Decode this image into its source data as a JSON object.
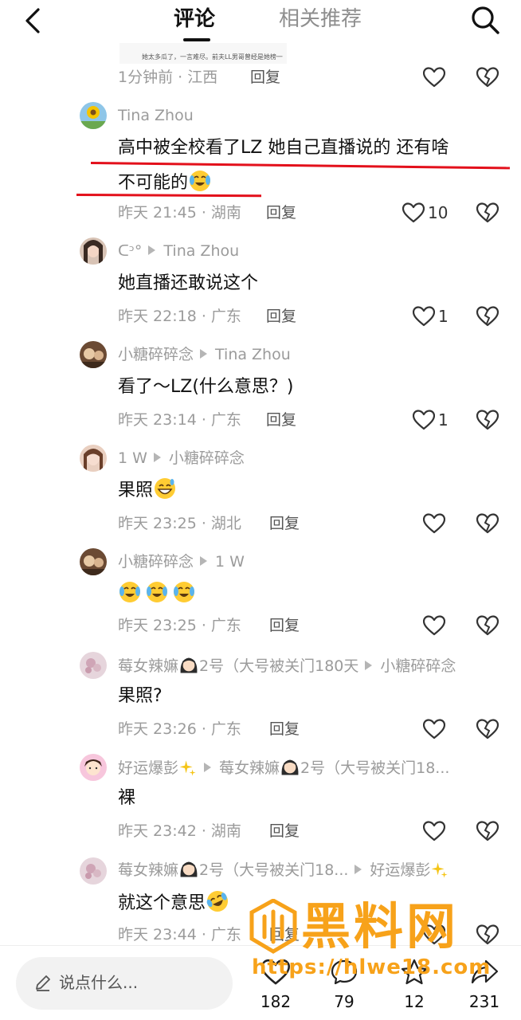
{
  "header": {
    "tab_comments": "评论",
    "tab_related": "相关推荐"
  },
  "image_sliver_text": "她太多瓜了，一言难尽。前夫LL男哥曾经是她榜一",
  "comments": [
    {
      "time": "1分钟前 · 江西",
      "reply": "回复"
    },
    {
      "user": "Tina Zhou",
      "text_line1": "高中被全校看了LZ 她自己直播说的 还有啥",
      "text_line2": "不可能的",
      "time": "昨天 21:45 · 湖南",
      "reply": "回复",
      "likes": "10"
    },
    {
      "user": "ᑕᵓ°",
      "reply_to": "Tina Zhou",
      "text": "她直播还敢说这个",
      "time": "昨天 22:18 · 广东",
      "reply": "回复",
      "likes": "1"
    },
    {
      "user": "小糖碎碎念",
      "reply_to": "Tina Zhou",
      "text": "看了～LZ(什么意思？)",
      "time": "昨天 23:14 · 广东",
      "reply": "回复",
      "likes": "1"
    },
    {
      "user": "1 W",
      "reply_to": "小糖碎碎念",
      "text": "果照",
      "time": "昨天 23:25 · 湖北",
      "reply": "回复"
    },
    {
      "user": "小糖碎碎念",
      "reply_to": "1 W",
      "text": "",
      "time": "昨天 23:25 · 广东",
      "reply": "回复"
    },
    {
      "user_a": "莓女辣嫲",
      "user_b": "2号（大号被关门180天",
      "reply_to": "小糖碎碎念",
      "text": "果照?",
      "time": "昨天 23:26 · 广东",
      "reply": "回复"
    },
    {
      "user": "好运爆彭",
      "reply_to_a": "莓女辣嫲",
      "reply_to_b": "2号（大号被关门18...",
      "text": "裸",
      "time": "昨天 23:42 · 湖南",
      "reply": "回复"
    },
    {
      "user_a": "莓女辣嫲",
      "user_b": "2号（大号被关门18...",
      "reply_to": "好运爆彭",
      "text": "就这个意思",
      "time": "昨天 23:44 · 广东",
      "reply": "回复"
    }
  ],
  "bottom": {
    "placeholder": "说点什么...",
    "like_count": "182",
    "comment_count": "79",
    "star_count": "12",
    "share_count": "231"
  },
  "watermark": {
    "title": "黑料网",
    "url": "https://hlwe18.com"
  },
  "colors": {
    "accent_underline": "#e3101b",
    "watermark": "#f7a21a",
    "meta_gray": "#9b9b9b"
  },
  "icons": [
    "back-icon",
    "search-icon",
    "heart-icon",
    "broken-heart-icon",
    "pencil-icon",
    "comment-icon",
    "star-icon",
    "share-icon"
  ]
}
